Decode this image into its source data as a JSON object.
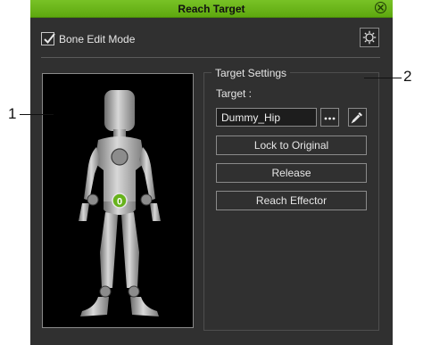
{
  "window": {
    "title": "Reach Target"
  },
  "bone_edit": {
    "label": "Bone Edit Mode",
    "checked": true
  },
  "target_settings": {
    "group_title": "Target Settings",
    "target_label": "Target :",
    "target_value": "Dummy_Hip",
    "more_button": "...",
    "buttons": [
      {
        "label": "Lock to Original"
      },
      {
        "label": "Release"
      },
      {
        "label": "Reach Effector"
      }
    ]
  },
  "viewport": {
    "hip_marker": "0"
  },
  "callouts": {
    "left": "1",
    "right": "2"
  },
  "colors": {
    "titlebar": "#6bb41a",
    "panel": "#303030",
    "marker": "#66b21b"
  }
}
